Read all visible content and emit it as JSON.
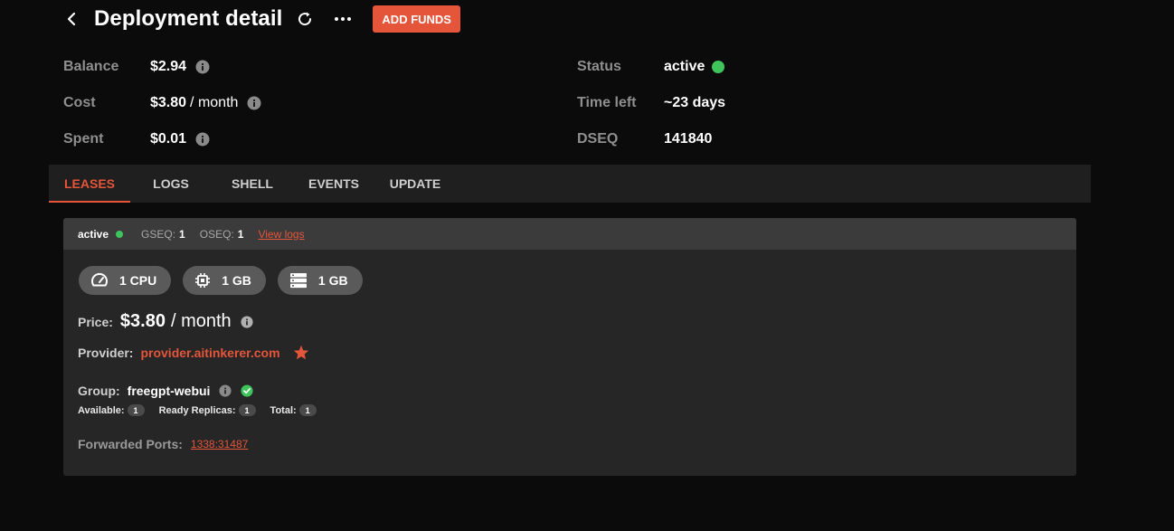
{
  "header": {
    "title": "Deployment detail",
    "add_funds_label": "ADD FUNDS"
  },
  "summary": {
    "balance": {
      "label": "Balance",
      "value": "$2.94"
    },
    "cost": {
      "label": "Cost",
      "value": "$3.80",
      "unit": "/ month"
    },
    "spent": {
      "label": "Spent",
      "value": "$0.01"
    },
    "status": {
      "label": "Status",
      "value": "active",
      "color": "#3ec45a"
    },
    "time_left": {
      "label": "Time left",
      "value": "~23 days"
    },
    "dseq": {
      "label": "DSEQ",
      "value": "141840"
    }
  },
  "tabs": [
    {
      "label": "LEASES",
      "active": true
    },
    {
      "label": "LOGS",
      "active": false
    },
    {
      "label": "SHELL",
      "active": false
    },
    {
      "label": "EVENTS",
      "active": false
    },
    {
      "label": "UPDATE",
      "active": false
    }
  ],
  "lease": {
    "status": "active",
    "gseq_label": "GSEQ:",
    "gseq_value": "1",
    "oseq_label": "OSEQ:",
    "oseq_value": "1",
    "view_logs_label": "View logs",
    "resources": [
      {
        "icon": "speedometer-icon",
        "label": "1 CPU"
      },
      {
        "icon": "memory-chip-icon",
        "label": "1 GB"
      },
      {
        "icon": "storage-icon",
        "label": "1 GB"
      }
    ],
    "price_label": "Price:",
    "price_value": "$3.80",
    "price_unit": "/ month",
    "provider_label": "Provider:",
    "provider_value": "provider.aitinkerer.com",
    "group_label": "Group:",
    "group_value": "freegpt-webui",
    "available_label": "Available:",
    "available_value": "1",
    "ready_label": "Ready Replicas:",
    "ready_value": "1",
    "total_label": "Total:",
    "total_value": "1",
    "ports_label": "Forwarded Ports:",
    "ports_value": "1338:31487"
  },
  "colors": {
    "accent": "#e4553a",
    "success": "#3ec45a",
    "background": "#0b0b0b",
    "card": "#262626"
  }
}
